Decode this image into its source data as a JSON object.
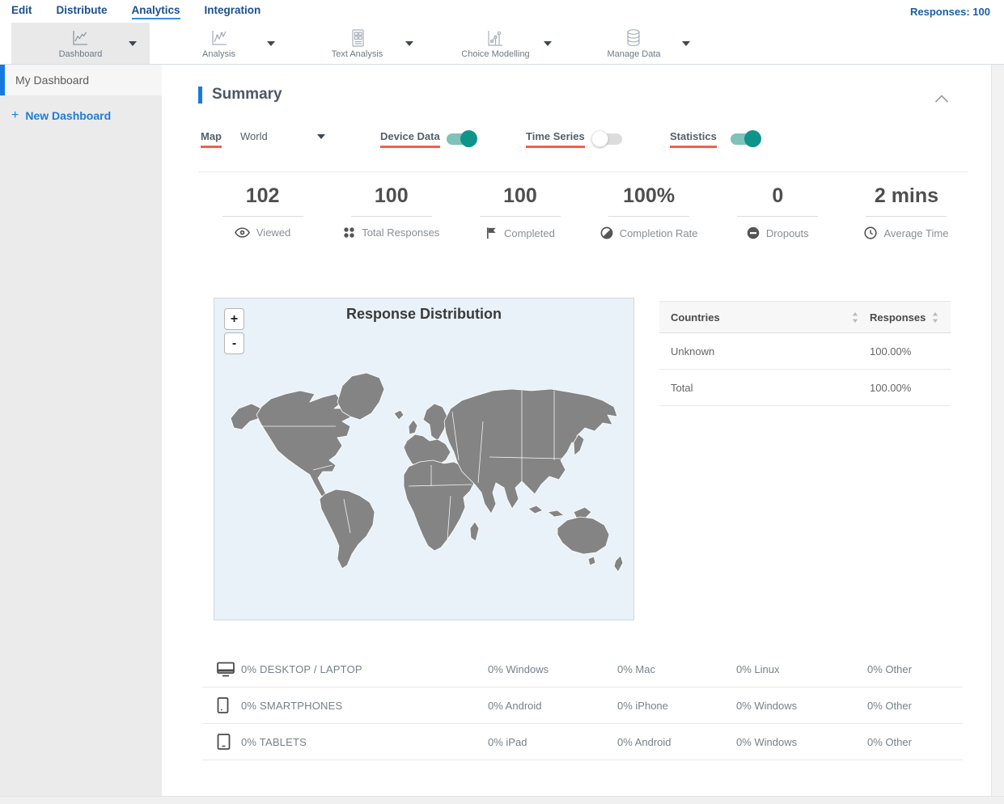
{
  "topnav": {
    "items": [
      "Edit",
      "Distribute",
      "Analytics",
      "Integration"
    ],
    "responses": "Responses: 100"
  },
  "toolbar": {
    "items": [
      {
        "label": "Dashboard"
      },
      {
        "label": "Analysis"
      },
      {
        "label": "Text Analysis"
      },
      {
        "label": "Choice Modelling"
      },
      {
        "label": "Manage Data"
      }
    ]
  },
  "sidebar": {
    "my_dashboard": "My Dashboard",
    "new_plus": "+",
    "new_dashboard": "New Dashboard"
  },
  "summary": {
    "title": "Summary",
    "controls": {
      "map_label": "Map",
      "region": "World",
      "toggles": [
        {
          "label": "Device Data",
          "on": true
        },
        {
          "label": "Time Series",
          "on": false
        },
        {
          "label": "Statistics",
          "on": true
        }
      ]
    },
    "stats": [
      {
        "value": "102",
        "label": "Viewed"
      },
      {
        "value": "100",
        "label": "Total Responses"
      },
      {
        "value": "100",
        "label": "Completed"
      },
      {
        "value": "100%",
        "label": "Completion Rate"
      },
      {
        "value": "0",
        "label": "Dropouts"
      },
      {
        "value": "2 mins",
        "label": "Average Time"
      }
    ],
    "map": {
      "title": "Response Distribution",
      "zoom_in": "+",
      "zoom_out": "-"
    },
    "countries_table": {
      "col_countries": "Countries",
      "col_responses": "Responses",
      "rows": [
        {
          "name": "Unknown",
          "value": "100.00%"
        },
        {
          "name": "Total",
          "value": "100.00%"
        }
      ]
    },
    "devices": [
      {
        "label": "0% DESKTOP / LAPTOP",
        "cols": [
          "0% Windows",
          "0% Mac",
          "0% Linux",
          "0% Other"
        ]
      },
      {
        "label": "0% SMARTPHONES",
        "cols": [
          "0% Android",
          "0% iPhone",
          "0% Windows",
          "0% Other"
        ]
      },
      {
        "label": "0% TABLETS",
        "cols": [
          "0% iPad",
          "0% Android",
          "0% Windows",
          "0% Other"
        ]
      }
    ]
  },
  "colors": {
    "accent_blue": "#1779e0",
    "nav_blue": "#1b4f8c",
    "underline_red": "#f0614e",
    "toggle_teal": "#0f948a"
  }
}
